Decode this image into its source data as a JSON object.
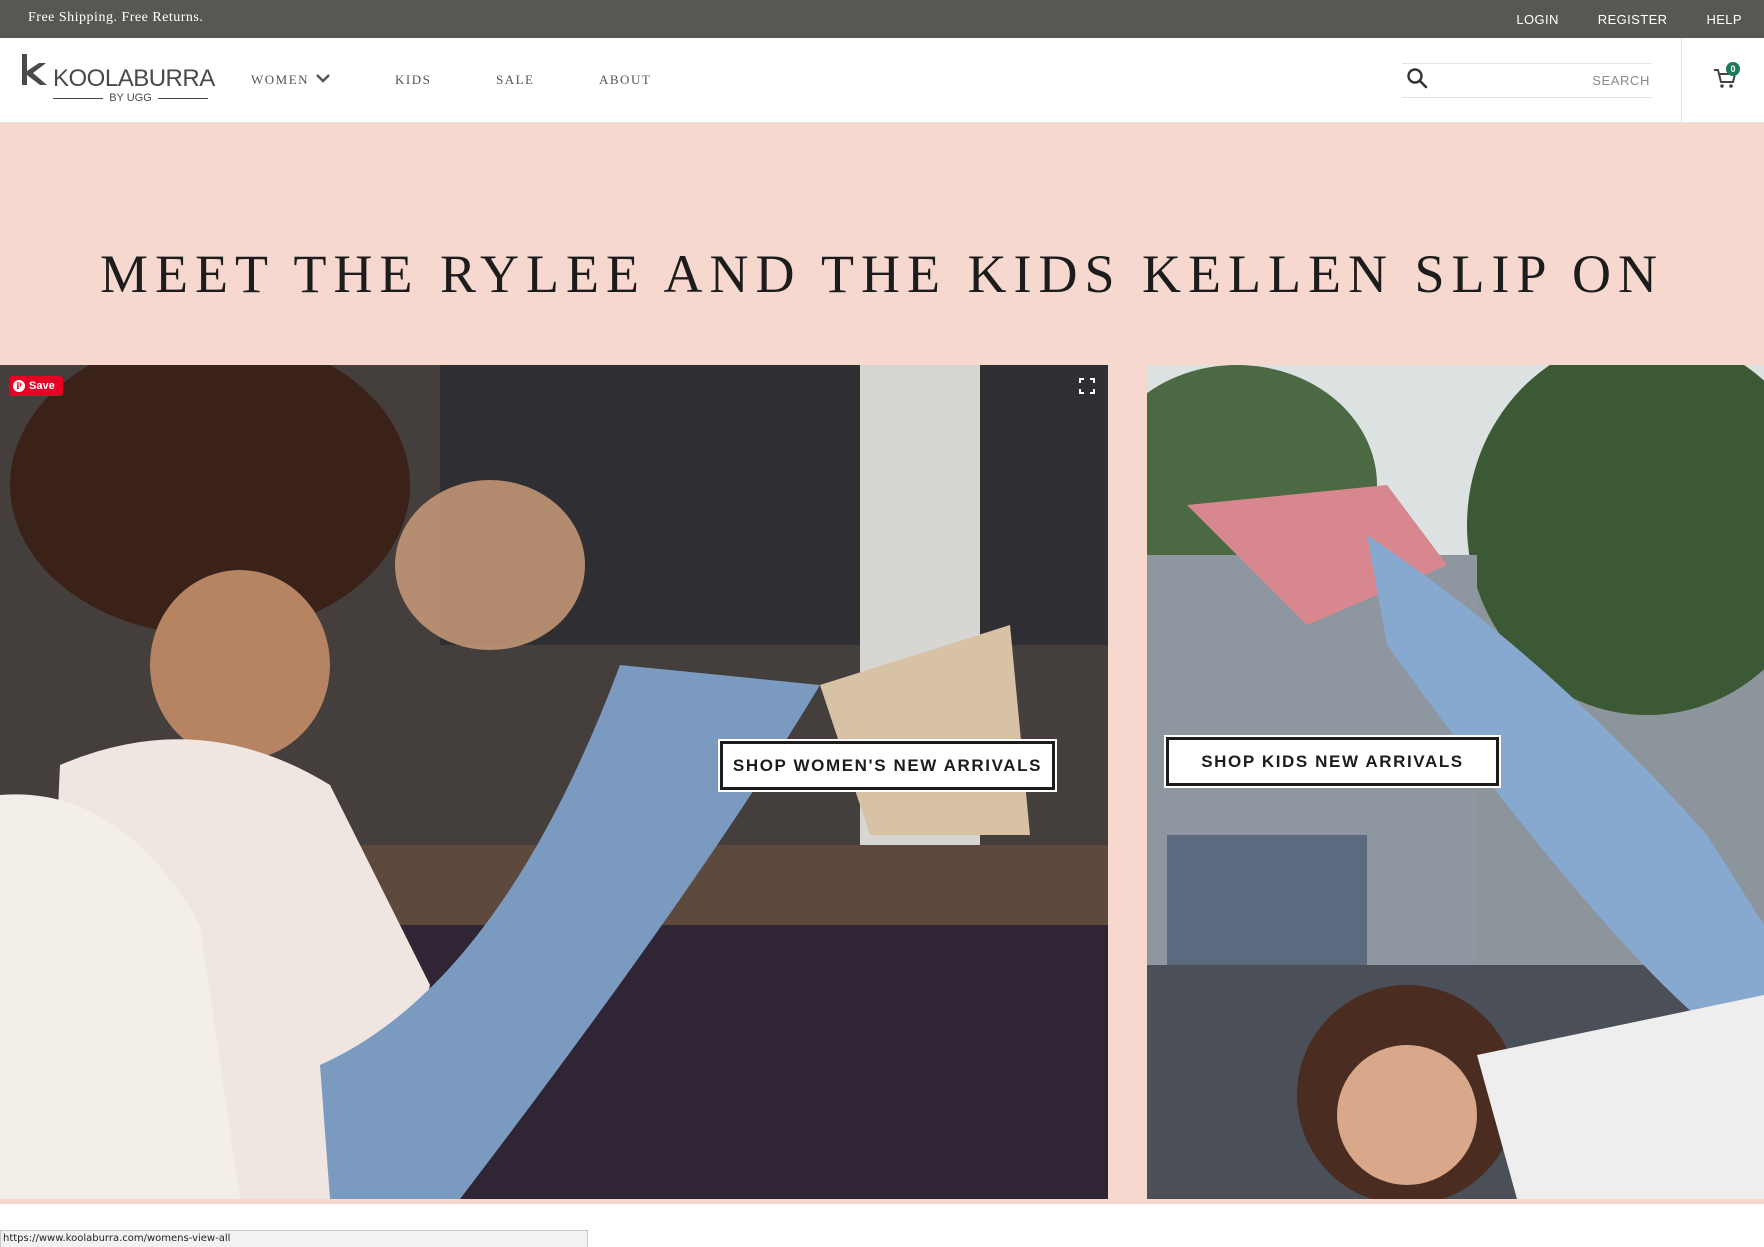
{
  "topbar": {
    "promo": "Free Shipping. Free Returns.",
    "login": "LOGIN",
    "register": "REGISTER",
    "help": "HELP"
  },
  "brand": {
    "name": "KOOLABURRA",
    "byline": "BY UGG",
    "icon": "koolaburra-k-logo-icon"
  },
  "nav": {
    "women": "WOMEN",
    "kids": "KIDS",
    "sale": "SALE",
    "about": "ABOUT"
  },
  "search": {
    "placeholder": "SEARCH",
    "value": "",
    "icon": "search-icon"
  },
  "cart": {
    "count": "0",
    "icon": "cart-icon",
    "badge_color": "#1d7a5c"
  },
  "hero": {
    "headline": "MEET THE RYLEE AND THE KIDS KELLEN SLIP ON",
    "background": "#f7d8cf",
    "pin_save": "Save",
    "cta_women": "SHOP WOMEN'S NEW ARRIVALS",
    "cta_kids": "SHOP KIDS NEW ARRIVALS"
  },
  "status": {
    "url": "https://www.koolaburra.com/womens-view-all"
  },
  "colors": {
    "topbar": "#585852",
    "pinterest": "#e60023"
  }
}
